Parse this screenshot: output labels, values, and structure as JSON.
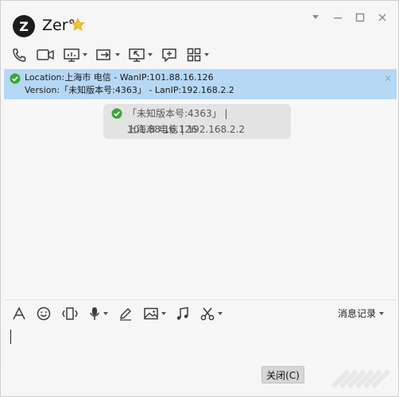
{
  "window": {
    "title": "Zer°",
    "avatar_letter": "Z"
  },
  "toolbar": {
    "icons": [
      "phone-icon",
      "video-icon",
      "screen-share-icon",
      "transfer-icon",
      "remote-desktop-icon",
      "message-add-icon",
      "apps-icon"
    ]
  },
  "info_bar": {
    "line1": "Location:上海市 电信 - WanIP:101.88.16.126",
    "line2": "Version:「未知版本号:4363」 - LanIP:192.168.2.2"
  },
  "bubble": {
    "line1": "「未知版本号:4363」 | 101.88.16.126",
    "line2": "上海市 电信 | 192.168.2.2"
  },
  "input_toolbar": {
    "icons": [
      "font-icon",
      "emoji-icon",
      "shake-icon",
      "mic-icon",
      "pen-icon",
      "image-icon",
      "music-icon",
      "scissors-icon"
    ],
    "history_label": "消息记录"
  },
  "actions": {
    "close_label": "关闭(C)"
  },
  "colors": {
    "info_bar_bg": "#b6d8f5",
    "check_green": "#3aa63a",
    "star_gold": "#f3c12b"
  }
}
